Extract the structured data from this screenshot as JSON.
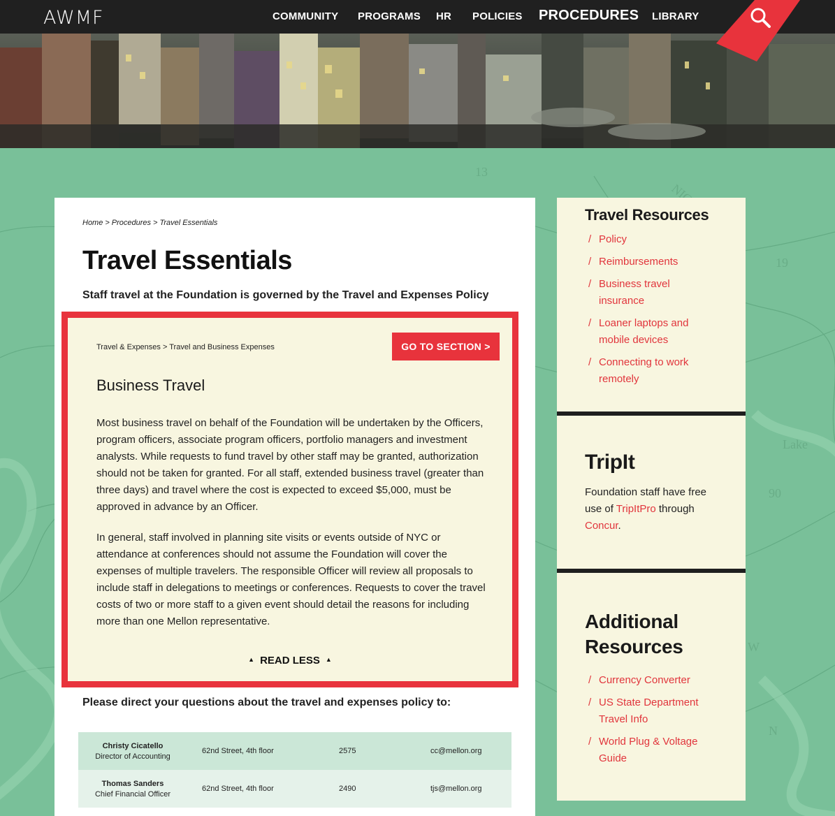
{
  "brand": {
    "logo": "AWMF",
    "accent": "#e8333c"
  },
  "nav": {
    "items": [
      "COMMUNITY",
      "PROGRAMS",
      "HR",
      "POLICIES",
      "PROCEDURES",
      "LIBRARY"
    ],
    "active": "PROCEDURES",
    "search_icon": "search-icon"
  },
  "breadcrumb": [
    "Home",
    "Procedures",
    "Travel Essentials"
  ],
  "page": {
    "title": "Travel Essentials",
    "subtitle": "Staff travel at the Foundation is governed by the Travel and Expenses Policy"
  },
  "feature": {
    "crumb": "Travel & Expenses > Travel and Business Expenses",
    "goto_label": "GO TO SECTION >",
    "title": "Business Travel",
    "paragraph1": "Most business travel on behalf of the Foundation will be undertaken by the Officers, program officers, associate program officers, portfolio managers and investment analysts.  While requests to fund travel by other staff may be granted, authorization should not be taken for granted.  For all staff, extended business travel (greater than three days) and travel where the cost is expected to exceed $5,000, must be approved in advance by an Officer.",
    "paragraph2": "In general, staff involved in planning site visits or events outside of NYC or attendance at conferences should not assume the Foundation will cover the expenses of multiple travelers.  The responsible Officer will review all proposals to include staff in delegations to meetings or conferences. Requests to cover the travel costs of two or more staff to a given event should detail the reasons for including more than one Mellon representative.",
    "read_less": "READ LESS"
  },
  "contacts": {
    "heading": "Please direct your questions about the travel and expenses policy to:",
    "rows": [
      {
        "name": "Christy Cicatello",
        "role": "Director of Accounting",
        "location": "62nd Street, 4th floor",
        "ext": "2575",
        "email": "cc@mellon.org"
      },
      {
        "name": "Thomas Sanders",
        "role": "Chief Financial Officer",
        "location": "62nd Street, 4th floor",
        "ext": "2490",
        "email": "tjs@mellon.org"
      }
    ]
  },
  "sidebar": {
    "travel_resources": {
      "title": "Travel Resources",
      "links": [
        "Policy",
        "Reimbursements",
        "Business travel insurance",
        "Loaner laptops and mobile devices",
        "Connecting to work remotely"
      ]
    },
    "tripit": {
      "title": "TripIt",
      "text_before": "Foundation staff have free use of ",
      "link1": "TripItPro",
      "text_middle": " through ",
      "link2": "Concur",
      "text_after": "."
    },
    "additional": {
      "title": "Additional Resources",
      "links": [
        "Currency Converter",
        "US State Department Travel Info",
        "World Plug & Voltage Guide"
      ]
    }
  }
}
